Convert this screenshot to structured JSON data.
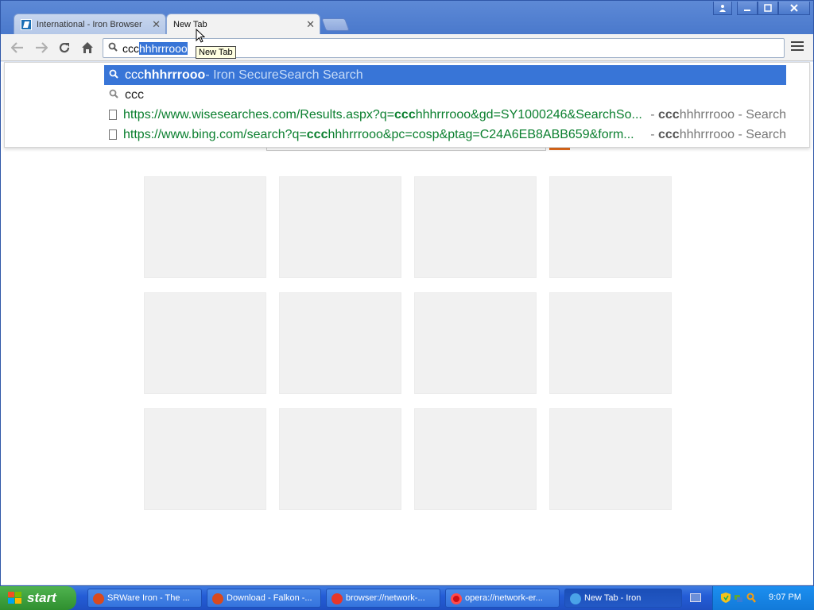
{
  "tabs": [
    {
      "title": "International - Iron Browser",
      "active": false
    },
    {
      "title": "New Tab",
      "active": true
    }
  ],
  "toolbar": {
    "omnibox_typed": "ccc",
    "omnibox_selected": "hhhrrrooo"
  },
  "tooltip": "New Tab",
  "suggestions": [
    {
      "query_typed": "ccc",
      "query_rest": "hhhrrrooo",
      "desc": " - Iron SecureSearch Search",
      "icon": "search-icon"
    },
    {
      "query": "ccc",
      "icon": "search-icon"
    },
    {
      "url_a": "https://www.wisesearches.com/Results.aspx?q=",
      "url_b": "ccc",
      "url_c": "hhhrrrooo&gd=SY1000246&SearchSo...",
      "desc_a": " - ",
      "desc_b": "ccc",
      "desc_c": "hhhrrrooo - Search",
      "icon": "page-icon"
    },
    {
      "url_a": "https://www.bing.com/search?q=",
      "url_b": "ccc",
      "url_c": "hhhrrrooo&pc=cosp&ptag=C24A6EB8ABB659&form...",
      "desc_a": " - ",
      "desc_b": "ccc",
      "desc_c": "hhhrrrooo - Search",
      "icon": "page-icon"
    }
  ],
  "taskbar": {
    "start_label": "start",
    "tasks": [
      {
        "label": "SRWare Iron - The ..."
      },
      {
        "label": "Download - Falkon -..."
      },
      {
        "label": "browser://network-..."
      },
      {
        "label": "opera://network-er..."
      },
      {
        "label": "New Tab - Iron"
      }
    ],
    "clock": "9:07 PM"
  },
  "colors": {
    "selection": "#3875d7",
    "url_green": "#0a7f2e",
    "search_go": "#e46c1d"
  }
}
